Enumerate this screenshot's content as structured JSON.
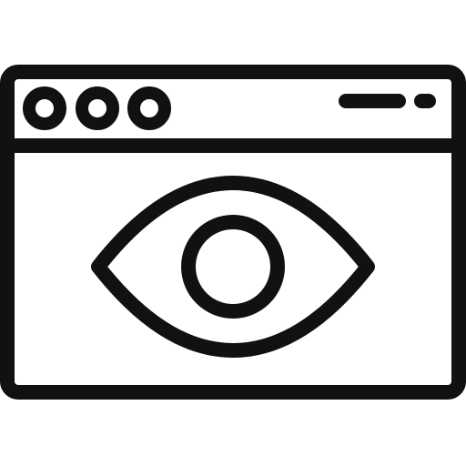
{
  "icon": {
    "name": "browser-window-eye-icon",
    "stroke_color": "#111111",
    "background_color": "#ffffff",
    "parts": [
      "browser-window-frame",
      "window-title-bar",
      "window-control-dots",
      "address-bar-dash",
      "eye-outline",
      "eye-pupil-ring"
    ]
  }
}
